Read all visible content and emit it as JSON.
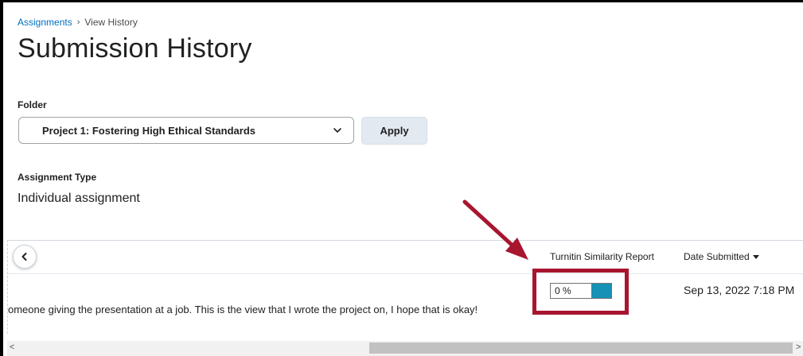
{
  "breadcrumb": {
    "link": "Assignments",
    "current": "View History"
  },
  "page_title": "Submission History",
  "folder": {
    "label": "Folder",
    "selected": "Project 1: Fostering High Ethical Standards",
    "apply_label": "Apply"
  },
  "assignment_type": {
    "label": "Assignment Type",
    "value": "Individual assignment"
  },
  "table": {
    "columns": {
      "turnitin": "Turnitin Similarity Report",
      "date_submitted": "Date Submitted"
    },
    "rows": [
      {
        "comment": "omeone giving the presentation at a job. This is the view that I wrote the project on, I hope that is okay!",
        "similarity_label": "0 %",
        "similarity": 0,
        "date": "Sep 13, 2022 7:18 PM"
      }
    ]
  },
  "colors": {
    "link": "#006fbf",
    "report_fill": "#1791b5",
    "highlight": "#a8152f",
    "apply_bg": "#e3e9f1"
  },
  "icons": {
    "select": "chevron-down-icon",
    "back": "chevron-left-icon",
    "sort": "sort-down-icon",
    "annotation": "pointer-arrow"
  }
}
